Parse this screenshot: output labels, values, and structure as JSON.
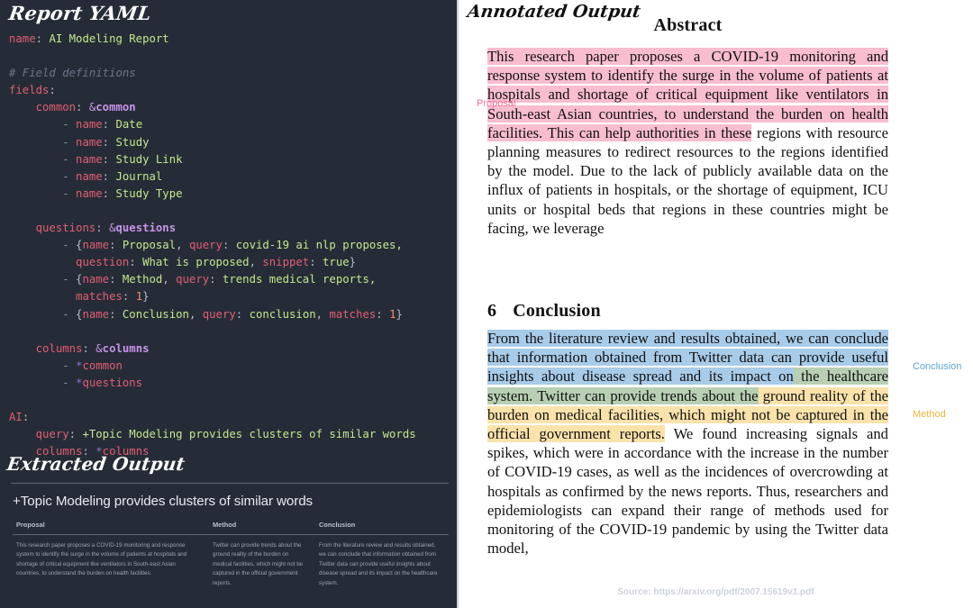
{
  "left": {
    "yaml_title": "Report YAML",
    "yaml_lines": [
      {
        "indent": 0,
        "segs": [
          {
            "t": "name",
            "c": "key"
          },
          {
            "t": ": ",
            "c": "punct"
          },
          {
            "t": "AI Modeling Report",
            "c": "str"
          }
        ]
      },
      {
        "indent": 0,
        "segs": []
      },
      {
        "indent": 0,
        "segs": [
          {
            "t": "# Field definitions",
            "c": "comment"
          }
        ]
      },
      {
        "indent": 0,
        "segs": [
          {
            "t": "fields",
            "c": "key"
          },
          {
            "t": ":",
            "c": "punct"
          }
        ]
      },
      {
        "indent": 4,
        "segs": [
          {
            "t": "common",
            "c": "key"
          },
          {
            "t": ": ",
            "c": "punct"
          },
          {
            "t": "&",
            "c": "anchor"
          },
          {
            "t": "common",
            "c": "anchname"
          }
        ]
      },
      {
        "indent": 8,
        "segs": [
          {
            "t": "- ",
            "c": "dash"
          },
          {
            "t": "name",
            "c": "key"
          },
          {
            "t": ": ",
            "c": "punct"
          },
          {
            "t": "Date",
            "c": "str"
          }
        ]
      },
      {
        "indent": 8,
        "segs": [
          {
            "t": "- ",
            "c": "dash"
          },
          {
            "t": "name",
            "c": "key"
          },
          {
            "t": ": ",
            "c": "punct"
          },
          {
            "t": "Study",
            "c": "str"
          }
        ]
      },
      {
        "indent": 8,
        "segs": [
          {
            "t": "- ",
            "c": "dash"
          },
          {
            "t": "name",
            "c": "key"
          },
          {
            "t": ": ",
            "c": "punct"
          },
          {
            "t": "Study Link",
            "c": "str"
          }
        ]
      },
      {
        "indent": 8,
        "segs": [
          {
            "t": "- ",
            "c": "dash"
          },
          {
            "t": "name",
            "c": "key"
          },
          {
            "t": ": ",
            "c": "punct"
          },
          {
            "t": "Journal",
            "c": "str"
          }
        ]
      },
      {
        "indent": 8,
        "segs": [
          {
            "t": "- ",
            "c": "dash"
          },
          {
            "t": "name",
            "c": "key"
          },
          {
            "t": ": ",
            "c": "punct"
          },
          {
            "t": "Study Type",
            "c": "str"
          }
        ]
      },
      {
        "indent": 0,
        "segs": []
      },
      {
        "indent": 4,
        "segs": [
          {
            "t": "questions",
            "c": "key"
          },
          {
            "t": ": ",
            "c": "punct"
          },
          {
            "t": "&",
            "c": "anchor"
          },
          {
            "t": "questions",
            "c": "anchname"
          }
        ]
      },
      {
        "indent": 8,
        "segs": [
          {
            "t": "- ",
            "c": "dash"
          },
          {
            "t": "{",
            "c": "punct"
          },
          {
            "t": "name",
            "c": "key"
          },
          {
            "t": ": ",
            "c": "punct"
          },
          {
            "t": "Proposal",
            "c": "str"
          },
          {
            "t": ", ",
            "c": "punct"
          },
          {
            "t": "query",
            "c": "key"
          },
          {
            "t": ": ",
            "c": "punct"
          },
          {
            "t": "covid-19 ai nlp proposes,",
            "c": "str"
          }
        ]
      },
      {
        "indent": 10,
        "segs": [
          {
            "t": "question",
            "c": "key"
          },
          {
            "t": ": ",
            "c": "punct"
          },
          {
            "t": "What is proposed",
            "c": "str"
          },
          {
            "t": ", ",
            "c": "punct"
          },
          {
            "t": "snippet",
            "c": "key"
          },
          {
            "t": ": ",
            "c": "punct"
          },
          {
            "t": "true",
            "c": "bool"
          },
          {
            "t": "}",
            "c": "punct"
          }
        ]
      },
      {
        "indent": 8,
        "segs": [
          {
            "t": "- ",
            "c": "dash"
          },
          {
            "t": "{",
            "c": "punct"
          },
          {
            "t": "name",
            "c": "key"
          },
          {
            "t": ": ",
            "c": "punct"
          },
          {
            "t": "Method",
            "c": "str"
          },
          {
            "t": ", ",
            "c": "punct"
          },
          {
            "t": "query",
            "c": "key"
          },
          {
            "t": ": ",
            "c": "punct"
          },
          {
            "t": "trends medical reports,",
            "c": "str"
          }
        ]
      },
      {
        "indent": 10,
        "segs": [
          {
            "t": "matches",
            "c": "key"
          },
          {
            "t": ": ",
            "c": "punct"
          },
          {
            "t": "1",
            "c": "num"
          },
          {
            "t": "}",
            "c": "punct"
          }
        ]
      },
      {
        "indent": 8,
        "segs": [
          {
            "t": "- ",
            "c": "dash"
          },
          {
            "t": "{",
            "c": "punct"
          },
          {
            "t": "name",
            "c": "key"
          },
          {
            "t": ": ",
            "c": "punct"
          },
          {
            "t": "Conclusion",
            "c": "str"
          },
          {
            "t": ", ",
            "c": "punct"
          },
          {
            "t": "query",
            "c": "key"
          },
          {
            "t": ": ",
            "c": "punct"
          },
          {
            "t": "conclusion",
            "c": "str"
          },
          {
            "t": ", ",
            "c": "punct"
          },
          {
            "t": "matches",
            "c": "key"
          },
          {
            "t": ": ",
            "c": "punct"
          },
          {
            "t": "1",
            "c": "num"
          },
          {
            "t": "}",
            "c": "punct"
          }
        ]
      },
      {
        "indent": 0,
        "segs": []
      },
      {
        "indent": 4,
        "segs": [
          {
            "t": "columns",
            "c": "key"
          },
          {
            "t": ": ",
            "c": "punct"
          },
          {
            "t": "&",
            "c": "anchor"
          },
          {
            "t": "columns",
            "c": "anchname"
          }
        ]
      },
      {
        "indent": 8,
        "segs": [
          {
            "t": "- ",
            "c": "dash"
          },
          {
            "t": "*",
            "c": "aliasmark"
          },
          {
            "t": "common",
            "c": "alias"
          }
        ]
      },
      {
        "indent": 8,
        "segs": [
          {
            "t": "- ",
            "c": "dash"
          },
          {
            "t": "*",
            "c": "aliasmark"
          },
          {
            "t": "questions",
            "c": "alias"
          }
        ]
      },
      {
        "indent": 0,
        "segs": []
      },
      {
        "indent": 0,
        "segs": [
          {
            "t": "AI",
            "c": "key"
          },
          {
            "t": ":",
            "c": "punct"
          }
        ]
      },
      {
        "indent": 4,
        "segs": [
          {
            "t": "query",
            "c": "key"
          },
          {
            "t": ": ",
            "c": "punct"
          },
          {
            "t": "+Topic Modeling provides clusters of similar words",
            "c": "str"
          }
        ]
      },
      {
        "indent": 4,
        "segs": [
          {
            "t": "columns",
            "c": "key"
          },
          {
            "t": ": ",
            "c": "punct"
          },
          {
            "t": "*",
            "c": "aliasmark"
          },
          {
            "t": "columns",
            "c": "alias"
          }
        ]
      }
    ],
    "extracted_title": "Extracted Output",
    "extracted_query": "+Topic Modeling provides clusters of similar words",
    "table": {
      "headers": [
        "Proposal",
        "Method",
        "Conclusion"
      ],
      "row": [
        "This research paper proposes a COVID-19 monitoring and response system to identify the surge in the volume of patients at hospitals and shortage of critical equipment like ventilators in South-east Asian countries, to understand the burden on health facilities.",
        "Twitter can provide trends about the ground reality of the burden on medical facilities, which might not be captured in the official government reports.",
        "From the literature review and results obtained, we can conclude that information obtained from Twitter data can provide useful insights about disease spread and its impact on the healthcare system."
      ]
    }
  },
  "right": {
    "annotated_title": "Annotated Output",
    "abstract": {
      "heading": "Abstract",
      "highlighted": "This research paper proposes a COVID-19 monitoring and response system to identify the surge in the volume of patients at hospitals and shortage of critical equipment like ventilators in South-east Asian countries, to understand the burden on health facilities. This can help authorities in these",
      "plain": " regions with resource planning measures to redirect resources to the regions identified by the model. Due to the lack of publicly available data on the influx of patients in hospitals, or the shortage of equipment, ICU units or hospital beds that regions in these countries might be facing, we leverage"
    },
    "conclusion": {
      "section_number": "6",
      "heading": "Conclusion",
      "blue_part": "From the literature review and results obtained, we can conclude that information obtained from Twitter data can provide useful insights about disease spread and its impact on",
      "overlap_part": " the healthcare system. Twitter can provide trends about the",
      "yellow_part": " ground reality of the burden on medical facilities, which might not be captured in the official government reports.",
      "plain_part": " We found increasing signals and spikes, which were in accordance with the increase in the number of COVID-19 cases, as well as the incidences of overcrowding at hospitals as confirmed by the news reports. Thus, researchers and epidemiologists can expand their range of methods used for monitoring of the COVID-19 pandemic by using the Twitter data model,"
    },
    "labels": {
      "proposal": "Proposal",
      "conclusion": "Conclusion",
      "method": "Method"
    },
    "source": "Source: https://arxiv.org/pdf/2007.15619v1.pdf"
  },
  "colors": {
    "panel_bg": "#262c37",
    "highlight_proposal": "#f9bdd0",
    "highlight_conclusion": "#a8cbe8",
    "highlight_method": "#fae2ab",
    "highlight_overlap": "#b9cfb4",
    "label_proposal": "#ef6f96",
    "label_conclusion": "#5fa3da",
    "label_method": "#f2b43c"
  }
}
